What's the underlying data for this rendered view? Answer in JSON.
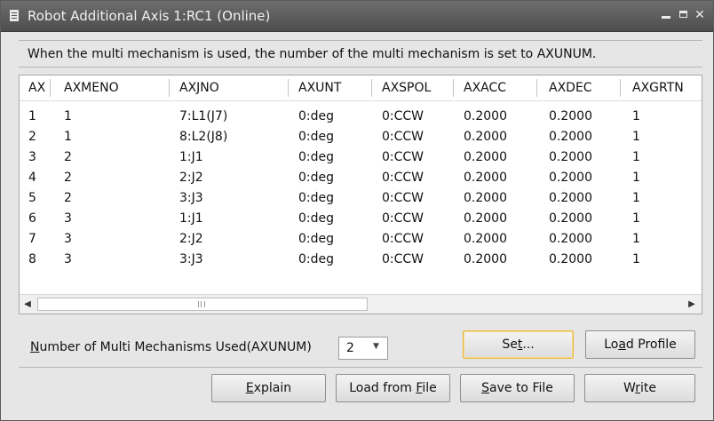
{
  "window": {
    "title": "Robot Additional Axis 1:RC1 (Online)"
  },
  "description": "When the multi mechanism is used, the number of the multi mechanism is set to AXUNUM.",
  "table": {
    "columns": [
      "AX",
      "AXMENO",
      "AXJNO",
      "AXUNT",
      "AXSPOL",
      "AXACC",
      "AXDEC",
      "AXGRTN"
    ],
    "rows": [
      [
        "1",
        "1",
        "7:L1(J7)",
        "0:deg",
        "0:CCW",
        "0.2000",
        "0.2000",
        "1"
      ],
      [
        "2",
        "1",
        "8:L2(J8)",
        "0:deg",
        "0:CCW",
        "0.2000",
        "0.2000",
        "1"
      ],
      [
        "3",
        "2",
        "1:J1",
        "0:deg",
        "0:CCW",
        "0.2000",
        "0.2000",
        "1"
      ],
      [
        "4",
        "2",
        "2:J2",
        "0:deg",
        "0:CCW",
        "0.2000",
        "0.2000",
        "1"
      ],
      [
        "5",
        "2",
        "3:J3",
        "0:deg",
        "0:CCW",
        "0.2000",
        "0.2000",
        "1"
      ],
      [
        "6",
        "3",
        "1:J1",
        "0:deg",
        "0:CCW",
        "0.2000",
        "0.2000",
        "1"
      ],
      [
        "7",
        "3",
        "2:J2",
        "0:deg",
        "0:CCW",
        "0.2000",
        "0.2000",
        "1"
      ],
      [
        "8",
        "3",
        "3:J3",
        "0:deg",
        "0:CCW",
        "0.2000",
        "0.2000",
        "1"
      ]
    ]
  },
  "axunum": {
    "label_prefix": "N",
    "label_rest": "umber of Multi Mechanisms Used(AXUNUM)",
    "value": "2"
  },
  "buttons": {
    "set": {
      "pre": "Se",
      "key": "t",
      "post": "..."
    },
    "load_profile": {
      "pre": "Lo",
      "key": "a",
      "post": "d Profile"
    },
    "explain": {
      "pre": "",
      "key": "E",
      "post": "xplain"
    },
    "load_from_file": {
      "pre": "Load from ",
      "key": "F",
      "post": "ile"
    },
    "save_to_file": {
      "pre": "",
      "key": "S",
      "post": "ave to File"
    },
    "write": {
      "pre": "W",
      "key": "r",
      "post": "ite"
    }
  },
  "icons": {
    "window_icon": "document-icon",
    "minimize": "minimize-icon",
    "maximize": "maximize-icon",
    "close": "close-icon",
    "scroll_left": "arrow-left-icon",
    "scroll_right": "arrow-right-icon",
    "combo_arrow": "chevron-down-icon"
  },
  "colors": {
    "titlebar": "#5a5a5a",
    "focus_border": "#e9b83c"
  }
}
